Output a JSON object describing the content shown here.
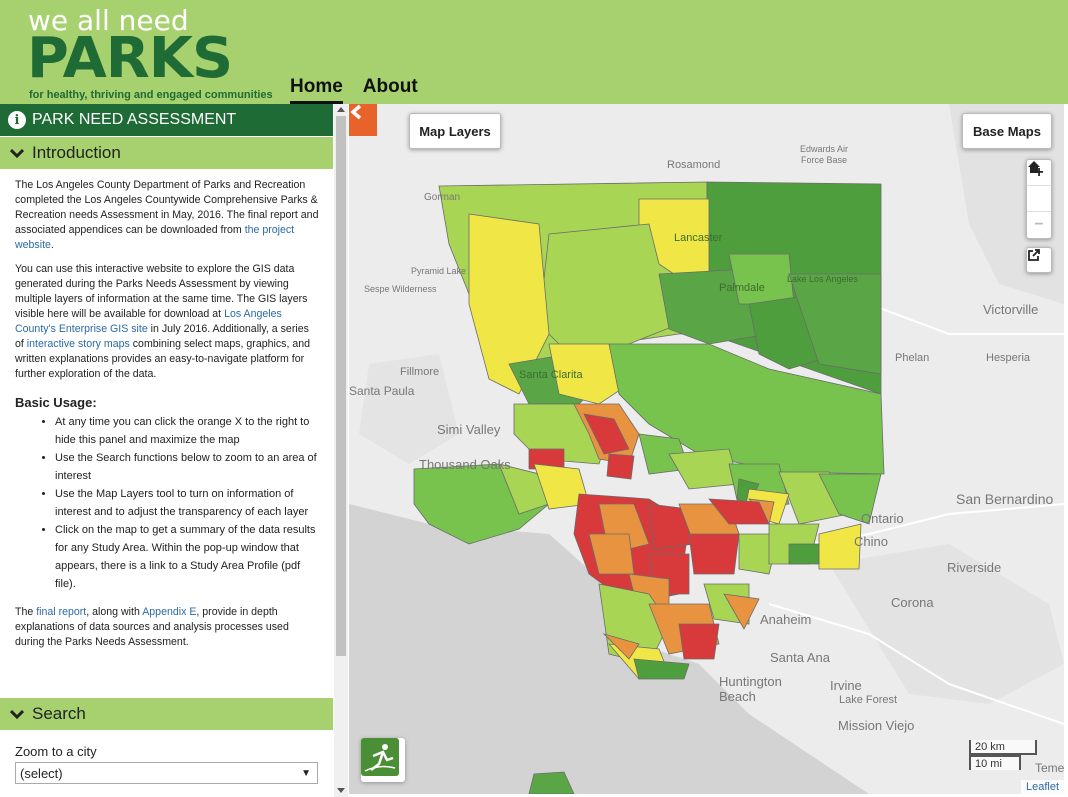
{
  "header": {
    "logo_top": "we all need",
    "logo_main": "PARKS",
    "logo_tagline": "for healthy, thriving and engaged communities",
    "nav": [
      {
        "label": "Home",
        "active": true
      },
      {
        "label": "About",
        "active": false
      }
    ],
    "bg_color": "#a6d16e",
    "brand_color": "#1f6b35"
  },
  "sidebar": {
    "title": "PARK NEED ASSESSMENT",
    "sections": {
      "introduction": "Introduction",
      "search": "Search"
    },
    "intro": {
      "p1_text": "The Los Angeles County Department of Parks and Recreation completed the Los Angeles Countywide Comprehensive Parks & Recreation needs Assessment in May, 2016. The final report and associated appendices can be downloaded from ",
      "p1_link": "the project website",
      "p1_end": ".",
      "p2_a": "You can use this interactive website to explore the GIS data generated during the Parks Needs Assessment by viewing multiple layers of information at the same time. The GIS layers visible here will be available for download at ",
      "p2_link1": "Los Angeles County's Enterprise GIS site",
      "p2_b": " in July 2016. Additionally, a series of ",
      "p2_link2": "interactive story maps",
      "p2_c": " combining select maps, graphics, and written explanations provides an easy-to-navigate platform for further exploration of the data.",
      "basic_usage_title": "Basic Usage:",
      "usage_items": [
        "At any time you can click the orange X to the right to hide this panel and maximize the map",
        "Use the Search functions below to zoom to an area of interest",
        "Use the Map Layers tool to turn on information of interest and to adjust the transparency of each layer",
        "Click on the map to get a summary of the data results for any Study Area. Within the pop-up window that appears, there is a link to a Study Area Profile (pdf file)."
      ],
      "p3_a": "The ",
      "p3_link1": "final report",
      "p3_b": ", along with ",
      "p3_link2": "Appendix E",
      "p3_c": ", provide in depth explanations of data sources and analysis processes used during the Parks Needs Assessment."
    },
    "search": {
      "zoom_label": "Zoom to a city",
      "zoom_value": "(select)"
    }
  },
  "map": {
    "buttons": {
      "layers": "Map Layers",
      "base": "Base Maps"
    },
    "zoom": {
      "in": "+",
      "out": "−"
    },
    "scale": {
      "km": "20 km",
      "mi": "10 mi"
    },
    "attribution": "Leaflet",
    "place_labels": [
      "Rosamond",
      "Edwards Air Force Base",
      "Gorman",
      "Lancaster",
      "Palmdale",
      "Lake Los Angeles",
      "Pyramid Lake",
      "Sespe Wilderness",
      "Santa Paula",
      "Fillmore",
      "Santa Clarita",
      "Victorville",
      "Phelan",
      "Hesperia",
      "Simi Valley",
      "Thousand Oaks",
      "San Bernardino",
      "Ontario",
      "Chino",
      "Riverside",
      "Corona",
      "Anaheim",
      "Santa Ana",
      "Irvine",
      "Huntington Beach",
      "Lake Forest",
      "Mission Viejo",
      "Temecula"
    ],
    "need_colors": {
      "very_low": "#4f9e3e",
      "low": "#78c24e",
      "moderate": "#a8d654",
      "high": "#f0e646",
      "very_high": "#e89340",
      "highest": "#d8393b"
    }
  }
}
